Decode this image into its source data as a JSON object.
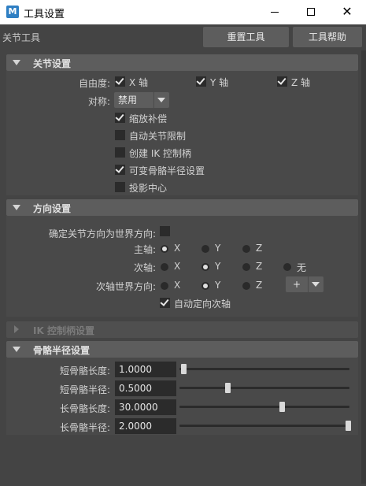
{
  "window": {
    "app_icon": "M",
    "title": "工具设置",
    "controls": {
      "minimize_icon": "minimize-icon",
      "maximize_icon": "maximize-icon",
      "close_icon": "close-icon",
      "close_glyph": "✕"
    }
  },
  "toolbar": {
    "tool_name": "关节工具",
    "reset_label": "重置工具",
    "help_label": "工具帮助"
  },
  "joint_settings": {
    "header": "关节设置",
    "dof_label": "自由度:",
    "dof": [
      {
        "label": "X 轴",
        "checked": true
      },
      {
        "label": "Y 轴",
        "checked": true
      },
      {
        "label": "Z 轴",
        "checked": true
      }
    ],
    "symmetry_label": "对称:",
    "symmetry_value": "禁用",
    "options": [
      {
        "label": "缩放补偿",
        "checked": true
      },
      {
        "label": "自动关节限制",
        "checked": false
      },
      {
        "label": "创建 IK 控制柄",
        "checked": false
      },
      {
        "label": "可变骨骼半径设置",
        "checked": true
      },
      {
        "label": "投影中心",
        "checked": false
      }
    ]
  },
  "orientation_settings": {
    "header": "方向设置",
    "world_orient_label": "确定关节方向为世界方向:",
    "world_orient_checked": false,
    "primary_axis": {
      "label": "主轴:",
      "options": [
        "X",
        "Y",
        "Z"
      ],
      "selected": "X"
    },
    "secondary_axis": {
      "label": "次轴:",
      "options": [
        "X",
        "Y",
        "Z",
        "无"
      ],
      "selected": "Y"
    },
    "secondary_world": {
      "label": "次轴世界方向:",
      "options": [
        "X",
        "Y",
        "Z"
      ],
      "selected": "Y",
      "sign_value": "+"
    },
    "auto_orient": {
      "label": "自动定向次轴",
      "checked": true
    }
  },
  "ik_handle_settings": {
    "header": "IK 控制柄设置",
    "collapsed": true
  },
  "bone_radius_settings": {
    "header": "骨骼半径设置",
    "rows": [
      {
        "label": "短骨骼长度:",
        "value": "1.0000",
        "slider_fraction": 0.0
      },
      {
        "label": "短骨骼半径:",
        "value": "0.5000",
        "slider_fraction": 0.27
      },
      {
        "label": "长骨骼长度:",
        "value": "30.0000",
        "slider_fraction": 0.6
      },
      {
        "label": "长骨骼半径:",
        "value": "2.0000",
        "slider_fraction": 1.0
      }
    ]
  }
}
